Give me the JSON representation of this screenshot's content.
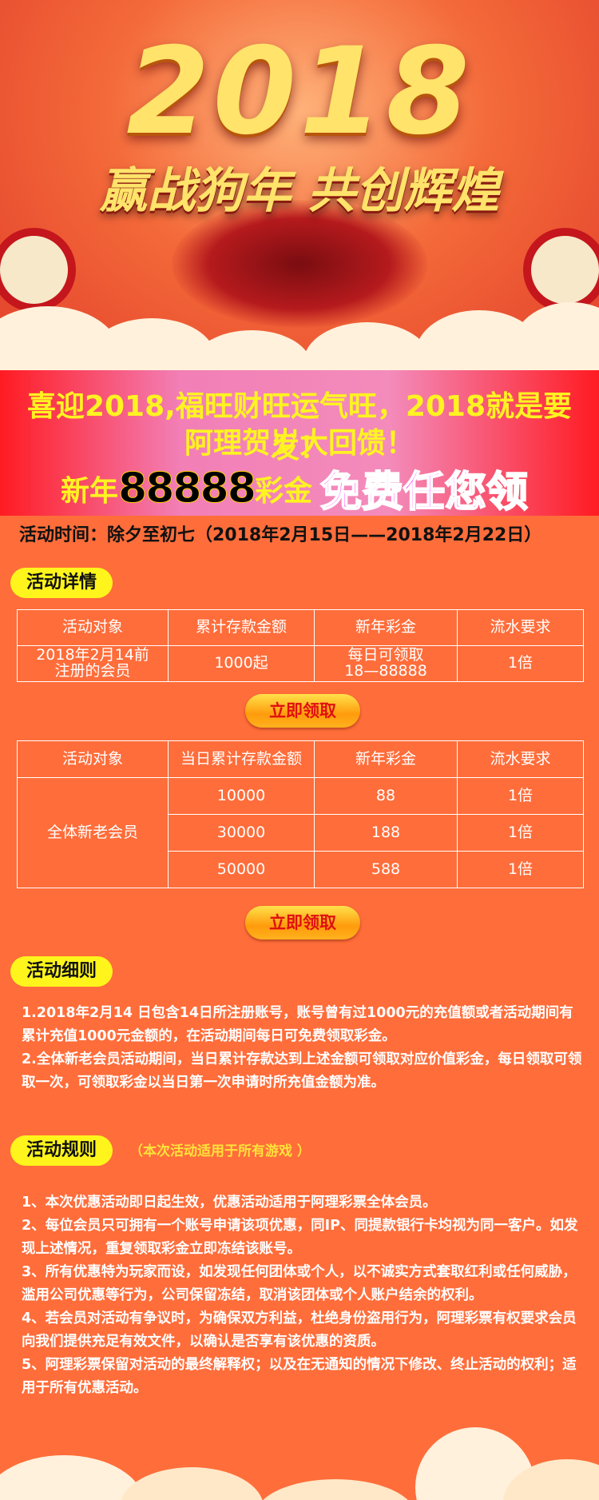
{
  "hero": {
    "year": "2018",
    "slogan": "赢战狗年 共创辉煌"
  },
  "banner": {
    "line1": "喜迎2018,福旺财旺运气旺，2018就是要发！",
    "line2": "阿理贺岁大回馈！",
    "line3_prefix": "新年",
    "line3_amount": "88888",
    "line3_suffix": "彩金",
    "line3_highlight": "免费任您领"
  },
  "activity_time": "活动时间：除夕至初七（2018年2月15日——2018年2月22日）",
  "details": {
    "title": "活动详情",
    "table1": {
      "headers": [
        "活动对象",
        "累计存款金额",
        "新年彩金",
        "流水要求"
      ],
      "row": [
        "2018年2月14前\n注册的会员",
        "1000起",
        "每日可领取\n18—88888",
        "1倍"
      ]
    },
    "claim_label": "立即领取",
    "table2": {
      "headers": [
        "活动对象",
        "当日累计存款金额",
        "新年彩金",
        "流水要求"
      ],
      "target": "全体新老会员",
      "rows": [
        [
          "10000",
          "88",
          "1倍"
        ],
        [
          "30000",
          "188",
          "1倍"
        ],
        [
          "50000",
          "588",
          "1倍"
        ]
      ]
    }
  },
  "terms": {
    "title": "活动细则",
    "items": [
      "1.2018年2月14 日包含14日所注册账号，账号曾有过1000元的充值额或者活动期间有累计充值1000元金额的，在活动期间每日可免费领取彩金。",
      "2.全体新老会员活动期间，当日累计存款达到上述金额可领取对应价值彩金，每日领取可领取一次，可领取彩金以当日第一次申请时所充值金额为准。"
    ]
  },
  "rules": {
    "title": "活动规则",
    "note": "（本次活动适用于所有游戏 ）",
    "items": [
      "1、本次优惠活动即日起生效，优惠活动适用于阿理彩票全体会员。",
      "2、每位会员只可拥有一个账号申请该项优惠，同IP、同提款银行卡均视为同一客户。如发现上述情况，重复领取彩金立即冻结该账号。",
      "3、所有优惠特为玩家而设，如发现任何团体或个人，以不诚实方式套取红利或任何威胁，滥用公司优惠等行为，公司保留冻结，取消该团体或个人账户结余的权利。",
      "4、若会员对活动有争议时，为确保双方利益，杜绝身份盗用行为，阿理彩票有权要求会员向我们提供充足有效文件，以确认是否享有该优惠的资质。",
      "5、阿理彩票保留对活动的最终解释权；以及在无通知的情况下修改、终止活动的权利；适用于所有优惠活动。"
    ]
  }
}
